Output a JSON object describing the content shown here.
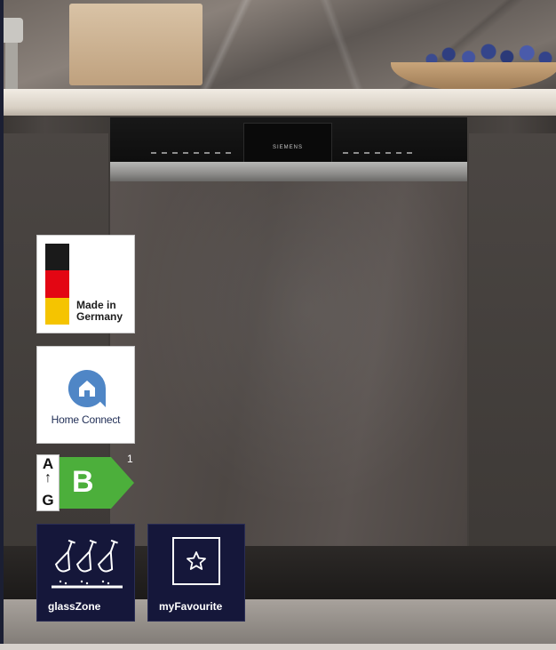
{
  "appliance": {
    "brand": "SIEMENS"
  },
  "badges": {
    "made_in_germany": {
      "line1": "Made in",
      "line2": "Germany",
      "flag_colors": [
        "#1a1a1a",
        "#e30613",
        "#f5c400"
      ]
    },
    "home_connect": {
      "label": "Home Connect",
      "icon": "home-connect-icon",
      "icon_color": "#4f86c6"
    }
  },
  "energy_label": {
    "scale_top": "A",
    "scale_arrow": "↑",
    "scale_bottom": "G",
    "class": "B",
    "class_color": "#4caf3b",
    "footnote": "1"
  },
  "features": [
    {
      "label": "glassZone",
      "icon": "wine-glasses-icon"
    },
    {
      "label": "myFavourite",
      "icon": "star-icon"
    }
  ],
  "colors": {
    "feature_bg": "#15173a",
    "page_bg": "#1b1f33"
  }
}
